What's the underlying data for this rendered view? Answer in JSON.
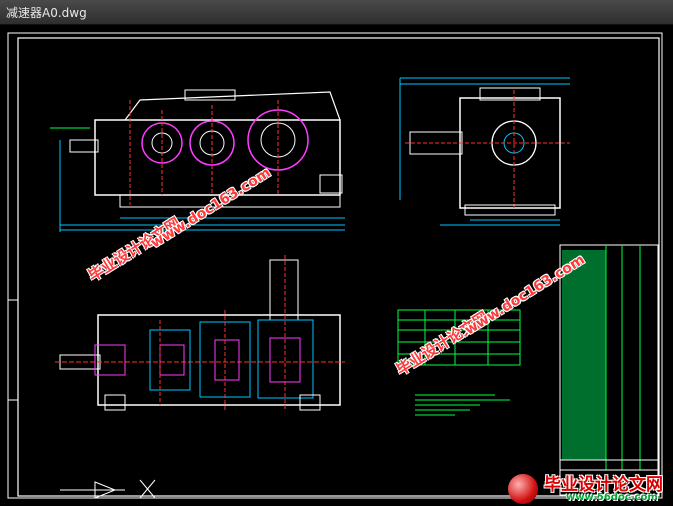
{
  "window": {
    "title": "减速器A0.dwg"
  },
  "watermarks": [
    {
      "cn": "毕业设计论文网",
      "en": "www.doc163.com"
    },
    {
      "cn": "毕业设计论文网",
      "en": "www.doc163.com"
    }
  ],
  "logo": {
    "cn": "毕业设计论文网",
    "url": "www.56doc.com"
  },
  "colors": {
    "background": "#000000",
    "frame": "#ffffff",
    "drawing_cyan": "#00c8ff",
    "drawing_magenta": "#ff3cff",
    "drawing_green": "#00ff40",
    "watermark_red": "#ff3a3a"
  }
}
